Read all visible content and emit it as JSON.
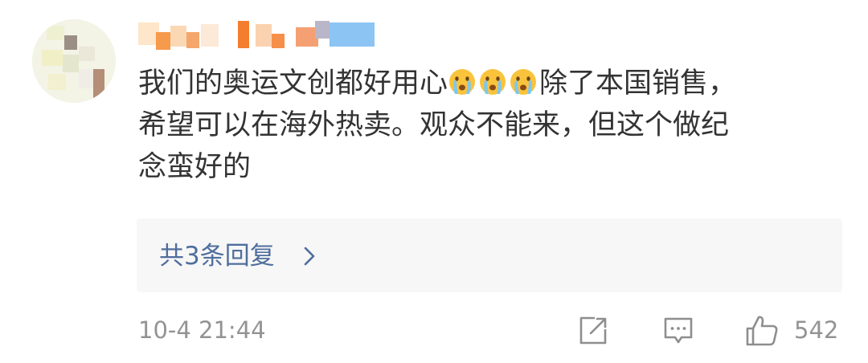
{
  "comment": {
    "lines": [
      {
        "before": "我们的奥运文创都好用心",
        "after": "除了本国销售，"
      },
      {
        "text": "希望可以在海外热卖。观众不能来，但这个做纪"
      },
      {
        "text": "念蛮好的"
      }
    ],
    "emojis": [
      "cry-emoji",
      "cry-emoji",
      "cry-emoji"
    ]
  },
  "replies": {
    "label": "共3条回复"
  },
  "footer": {
    "timestamp": "10-4 21:44",
    "like_count": "542"
  },
  "colors": {
    "body_text": "#333333",
    "link": "#4f6e9d",
    "meta": "#939393",
    "reply_bg": "#f7f7f7"
  },
  "icons": [
    "share-icon",
    "comment-icon",
    "thumbs-up-icon",
    "chevron-right-icon",
    "cry-emoji"
  ]
}
